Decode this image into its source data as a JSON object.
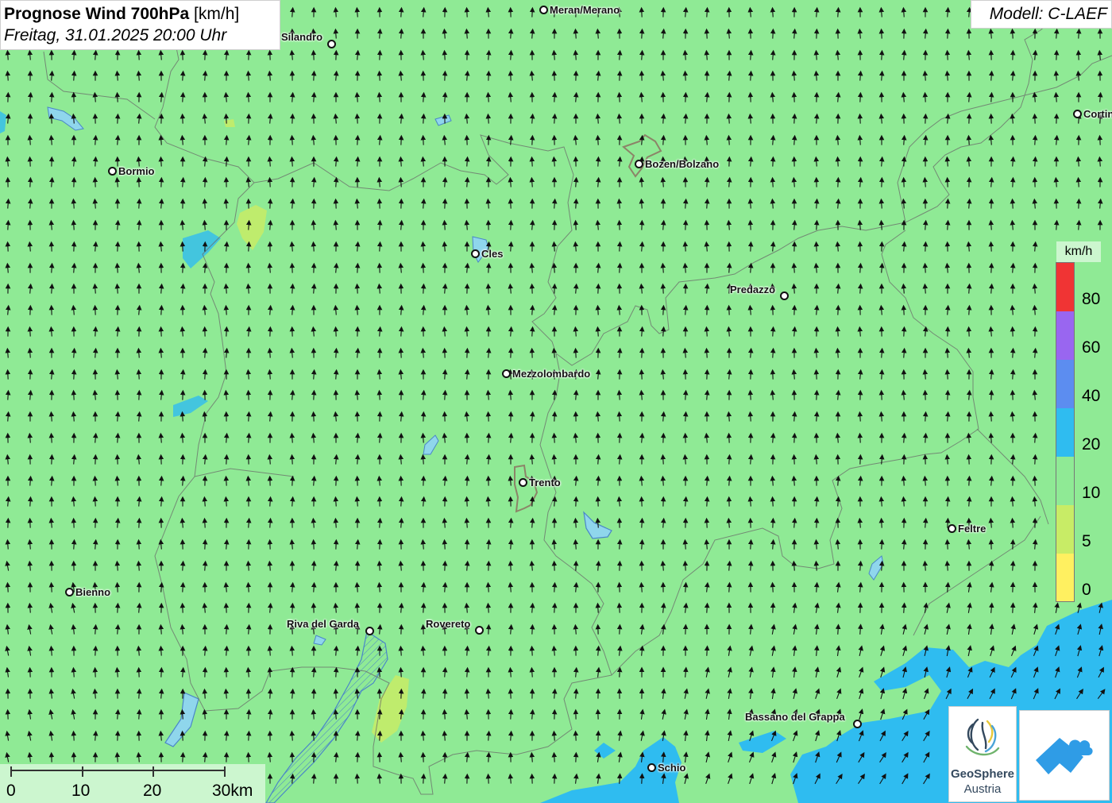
{
  "header": {
    "title_bold": "Prognose Wind 700hPa",
    "title_unit": " [km/h]",
    "subtitle": "Freitag, 31.01.2025 20:00 Uhr",
    "model": "Modell: C-LAEF"
  },
  "legend": {
    "unit": "km/h",
    "ticks": [
      "80",
      "60",
      "40",
      "20",
      "10",
      "5",
      "0"
    ],
    "colors": [
      "#f03434",
      "#9966f0",
      "#5c8df0",
      "#2fbcf0",
      "#8fea95",
      "#c8ec66",
      "#fff060"
    ]
  },
  "scale_bar": {
    "labels": [
      "0",
      "10",
      "20",
      "30km"
    ]
  },
  "cities": [
    {
      "name": "Meran/Merano"
    },
    {
      "name": "Silandro"
    },
    {
      "name": "Cortina"
    },
    {
      "name": "Bormio"
    },
    {
      "name": "Bozen/Bolzano"
    },
    {
      "name": "Cles"
    },
    {
      "name": "Predazzo"
    },
    {
      "name": "Mezzolombardo"
    },
    {
      "name": "Trento"
    },
    {
      "name": "Feltre"
    },
    {
      "name": "Bienno"
    },
    {
      "name": "Riva del Garda"
    },
    {
      "name": "Rovereto"
    },
    {
      "name": "Bassano del Grappa"
    },
    {
      "name": "Schio"
    }
  ],
  "logos": {
    "geosphere_line1": "GeoSphere",
    "geosphere_line2": "Austria",
    "icon2": "wind-cloud-logo-icon"
  },
  "map_colors": {
    "base": "#8fea95",
    "low": "#c8ec66",
    "high": "#2fbcf0",
    "lake": "#6ab0ec"
  }
}
